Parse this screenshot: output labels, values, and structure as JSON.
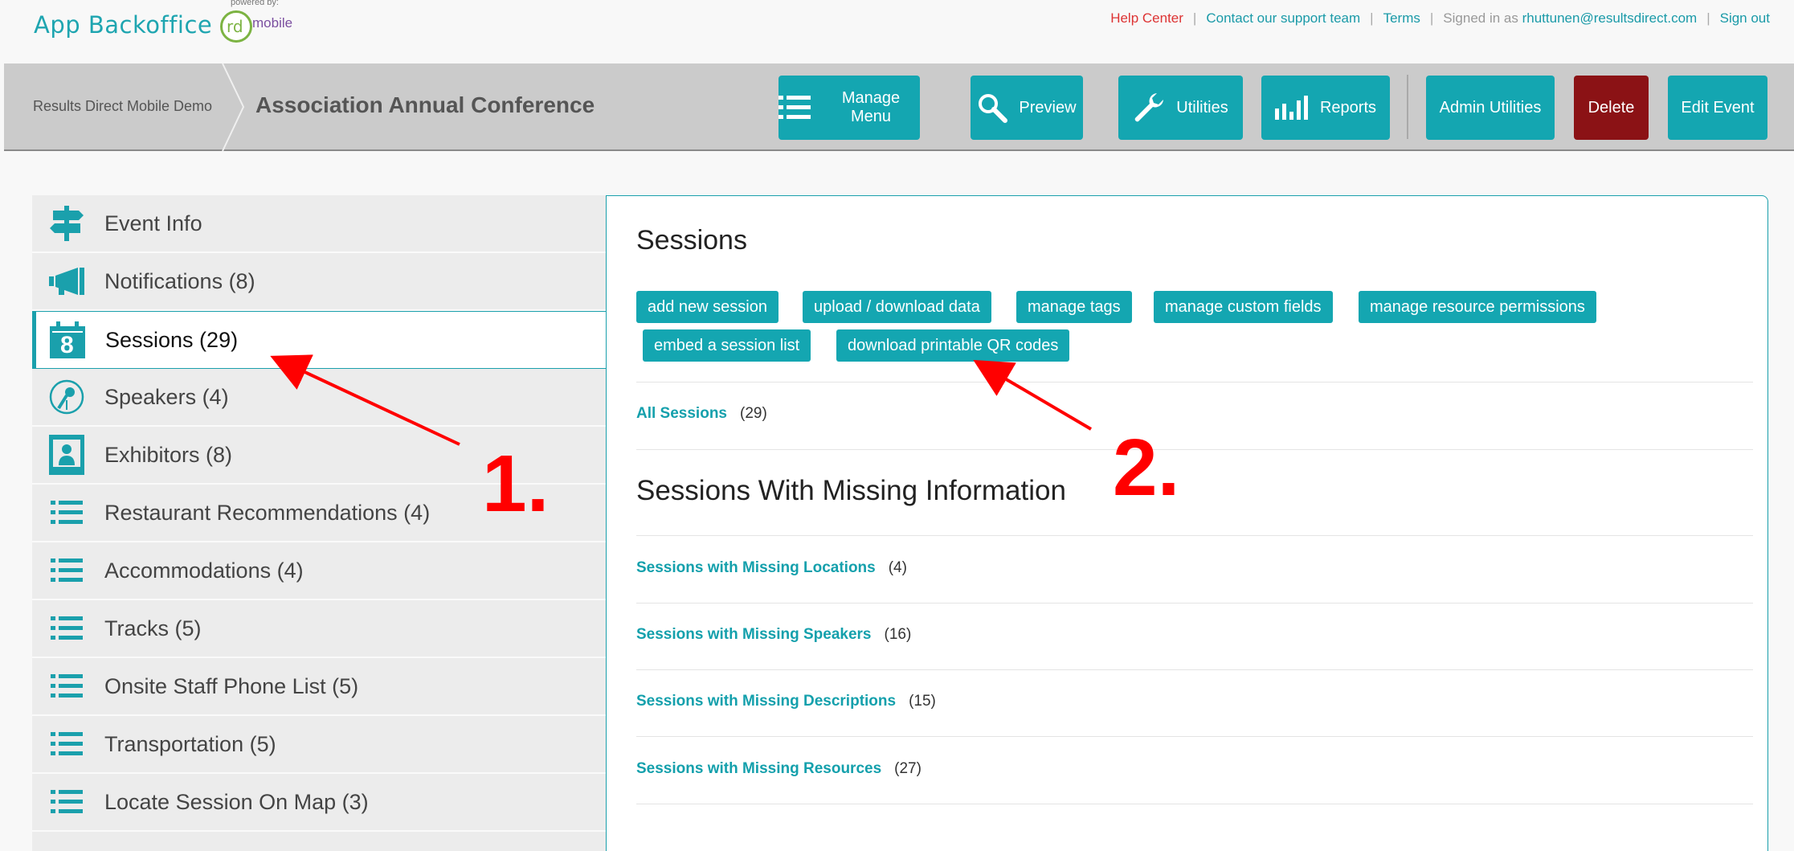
{
  "topbar": {
    "logo": "App Backoffice",
    "powered_by": "powered by:",
    "rd_mark": "rd",
    "rd_word": "mobile",
    "help": "Help Center",
    "support": "Contact our support team",
    "terms": "Terms",
    "signed_in_prefix": "Signed in as",
    "email": "rhuttunen@resultsdirect.com",
    "sign_out": "Sign out"
  },
  "header": {
    "breadcrumb": "Results Direct Mobile Demo",
    "event_title": "Association Annual Conference",
    "buttons": {
      "manage_menu": "Manage Menu",
      "preview": "Preview",
      "utilities": "Utilities",
      "reports": "Reports",
      "admin_utilities": "Admin Utilities",
      "delete": "Delete",
      "edit_event": "Edit Event"
    }
  },
  "sidebar": {
    "items": [
      {
        "label": "Event Info",
        "icon": "signpost-icon"
      },
      {
        "label": "Notifications (8)",
        "icon": "megaphone-icon"
      },
      {
        "label": "Sessions (29)",
        "icon": "calendar-icon"
      },
      {
        "label": "Speakers (4)",
        "icon": "microphone-icon"
      },
      {
        "label": "Exhibitors (8)",
        "icon": "booth-icon"
      },
      {
        "label": "Restaurant Recommendations (4)",
        "icon": "list-icon"
      },
      {
        "label": "Accommodations (4)",
        "icon": "list-icon"
      },
      {
        "label": "Tracks (5)",
        "icon": "list-icon"
      },
      {
        "label": "Onsite Staff Phone List (5)",
        "icon": "list-icon"
      },
      {
        "label": "Transportation (5)",
        "icon": "list-icon"
      },
      {
        "label": "Locate Session On Map (3)",
        "icon": "list-icon"
      }
    ],
    "calendar_number": "8"
  },
  "main": {
    "title": "Sessions",
    "actions": {
      "add": "add new session",
      "upload": "upload / download data",
      "tags": "manage tags",
      "custom": "manage custom fields",
      "perms": "manage resource permissions",
      "embed": "embed a session list",
      "qr": "download printable QR codes"
    },
    "all_sessions": {
      "label": "All Sessions",
      "count": "(29)"
    },
    "missing_title": "Sessions With Missing Information",
    "missing": [
      {
        "label": "Sessions with Missing Locations",
        "count": "(4)"
      },
      {
        "label": "Sessions with Missing Speakers",
        "count": "(16)"
      },
      {
        "label": "Sessions with Missing Descriptions",
        "count": "(15)"
      },
      {
        "label": "Sessions with Missing Resources",
        "count": "(27)"
      }
    ]
  },
  "annotations": {
    "one": "1.",
    "two": "2.",
    "color": "#ff0000"
  },
  "colors": {
    "accent": "#14a6b1",
    "danger": "#8b1215",
    "link_red": "#dd3333"
  }
}
